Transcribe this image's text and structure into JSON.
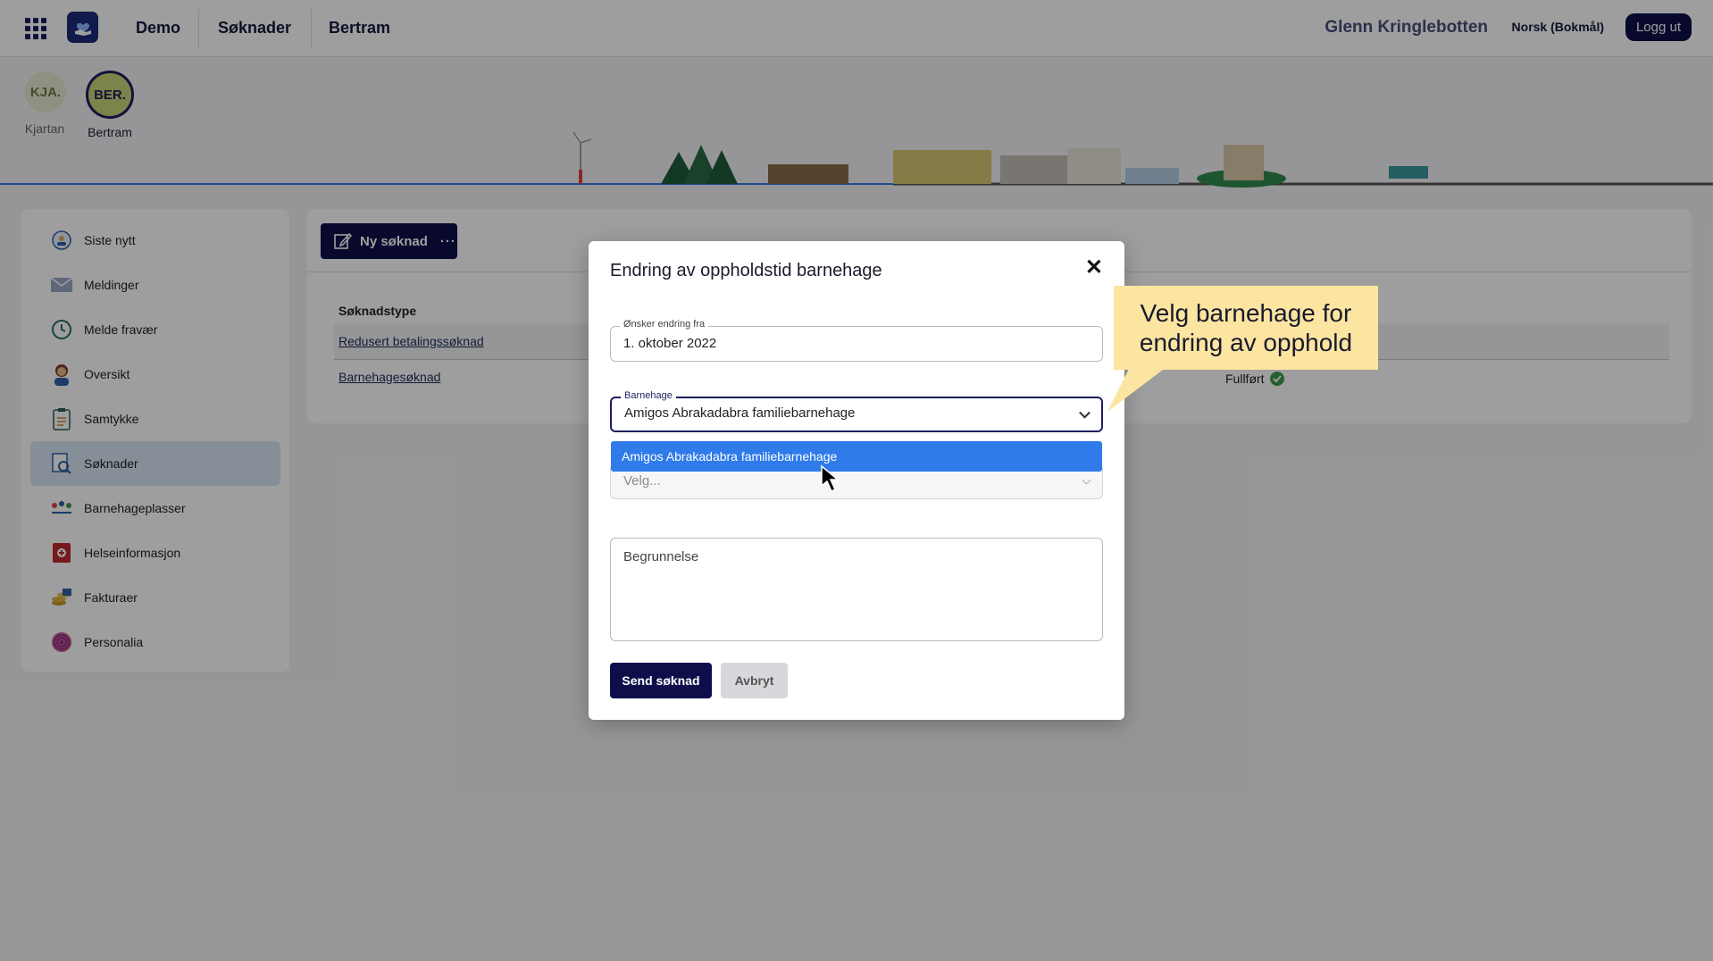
{
  "topbar": {
    "nav": [
      "Demo",
      "Søknader",
      "Bertram"
    ],
    "user_name": "Glenn Kringlebotten",
    "language": "Norsk (Bokmål)",
    "logout_label": "Logg ut"
  },
  "children": [
    {
      "initials": "KJA.",
      "name": "Kjartan"
    },
    {
      "initials": "BER.",
      "name": "Bertram"
    }
  ],
  "sidebar": {
    "items": [
      {
        "label": "Siste nytt",
        "icon": "news-icon"
      },
      {
        "label": "Meldinger",
        "icon": "mail-icon"
      },
      {
        "label": "Melde fravær",
        "icon": "clock-icon"
      },
      {
        "label": "Oversikt",
        "icon": "person-icon"
      },
      {
        "label": "Samtykke",
        "icon": "clipboard-icon"
      },
      {
        "label": "Søknader",
        "icon": "search-document-icon",
        "active": true
      },
      {
        "label": "Barnehageplasser",
        "icon": "kindergarten-icon"
      },
      {
        "label": "Helseinformasjon",
        "icon": "health-icon"
      },
      {
        "label": "Fakturaer",
        "icon": "coins-icon"
      },
      {
        "label": "Personalia",
        "icon": "fingerprint-icon"
      }
    ]
  },
  "main": {
    "new_button_label": "Ny søknad",
    "new_button_more": "···",
    "column_header": "Søknadstype",
    "rows": [
      {
        "type": "Redusert betalingssøknad",
        "status": ""
      },
      {
        "type": "Barnehagesøknad",
        "status": "Fullført"
      }
    ]
  },
  "modal": {
    "title": "Endring av oppholdstid barnehage",
    "close_label": "✕",
    "date_field": {
      "label": "Ønsker endring fra",
      "value": "1. oktober 2022"
    },
    "kindergarten_field": {
      "label": "Barnehage",
      "value": "Amigos Abrakadabra familiebarnehage"
    },
    "dropdown_option": "Amigos Abrakadabra familiebarnehage",
    "select_placeholder": "Velg...",
    "reason_placeholder": "Begrunnelse",
    "send_label": "Send søknad",
    "cancel_label": "Avbryt"
  },
  "callout": {
    "text_line1": "Velg barnehage for",
    "text_line2": "endring av opphold"
  },
  "colors": {
    "primary": "#0e0f4a",
    "highlight": "#2f7bea",
    "callout": "#fbe5a0",
    "success": "#3d9a4a"
  }
}
